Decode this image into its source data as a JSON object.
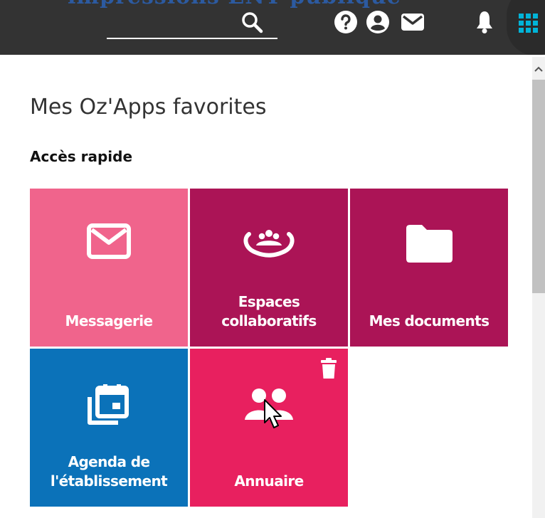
{
  "header": {
    "cut_title": "lmpressions ENT publique",
    "icons": [
      "search-icon",
      "help-icon",
      "user-icon",
      "mail-icon",
      "bell-icon",
      "apps-grid-icon"
    ],
    "colors": {
      "bar": "#333333",
      "apps_accent": "#00b4d8"
    }
  },
  "main": {
    "title": "Mes Oz'Apps favorites",
    "section": "Accès rapide",
    "tiles": [
      {
        "label": "Messagerie",
        "icon": "envelope-icon",
        "color": "#f0648c"
      },
      {
        "label": "Espaces collaboratifs",
        "icon": "group-icon",
        "color": "#ab1456"
      },
      {
        "label": "Mes documents",
        "icon": "folder-icon",
        "color": "#ab1456"
      },
      {
        "label": "Agenda de l'établissement",
        "icon": "calendar-icon",
        "color": "#0b72b9"
      },
      {
        "label": "Annuaire",
        "icon": "contacts-icon",
        "color": "#e8205f"
      }
    ]
  }
}
